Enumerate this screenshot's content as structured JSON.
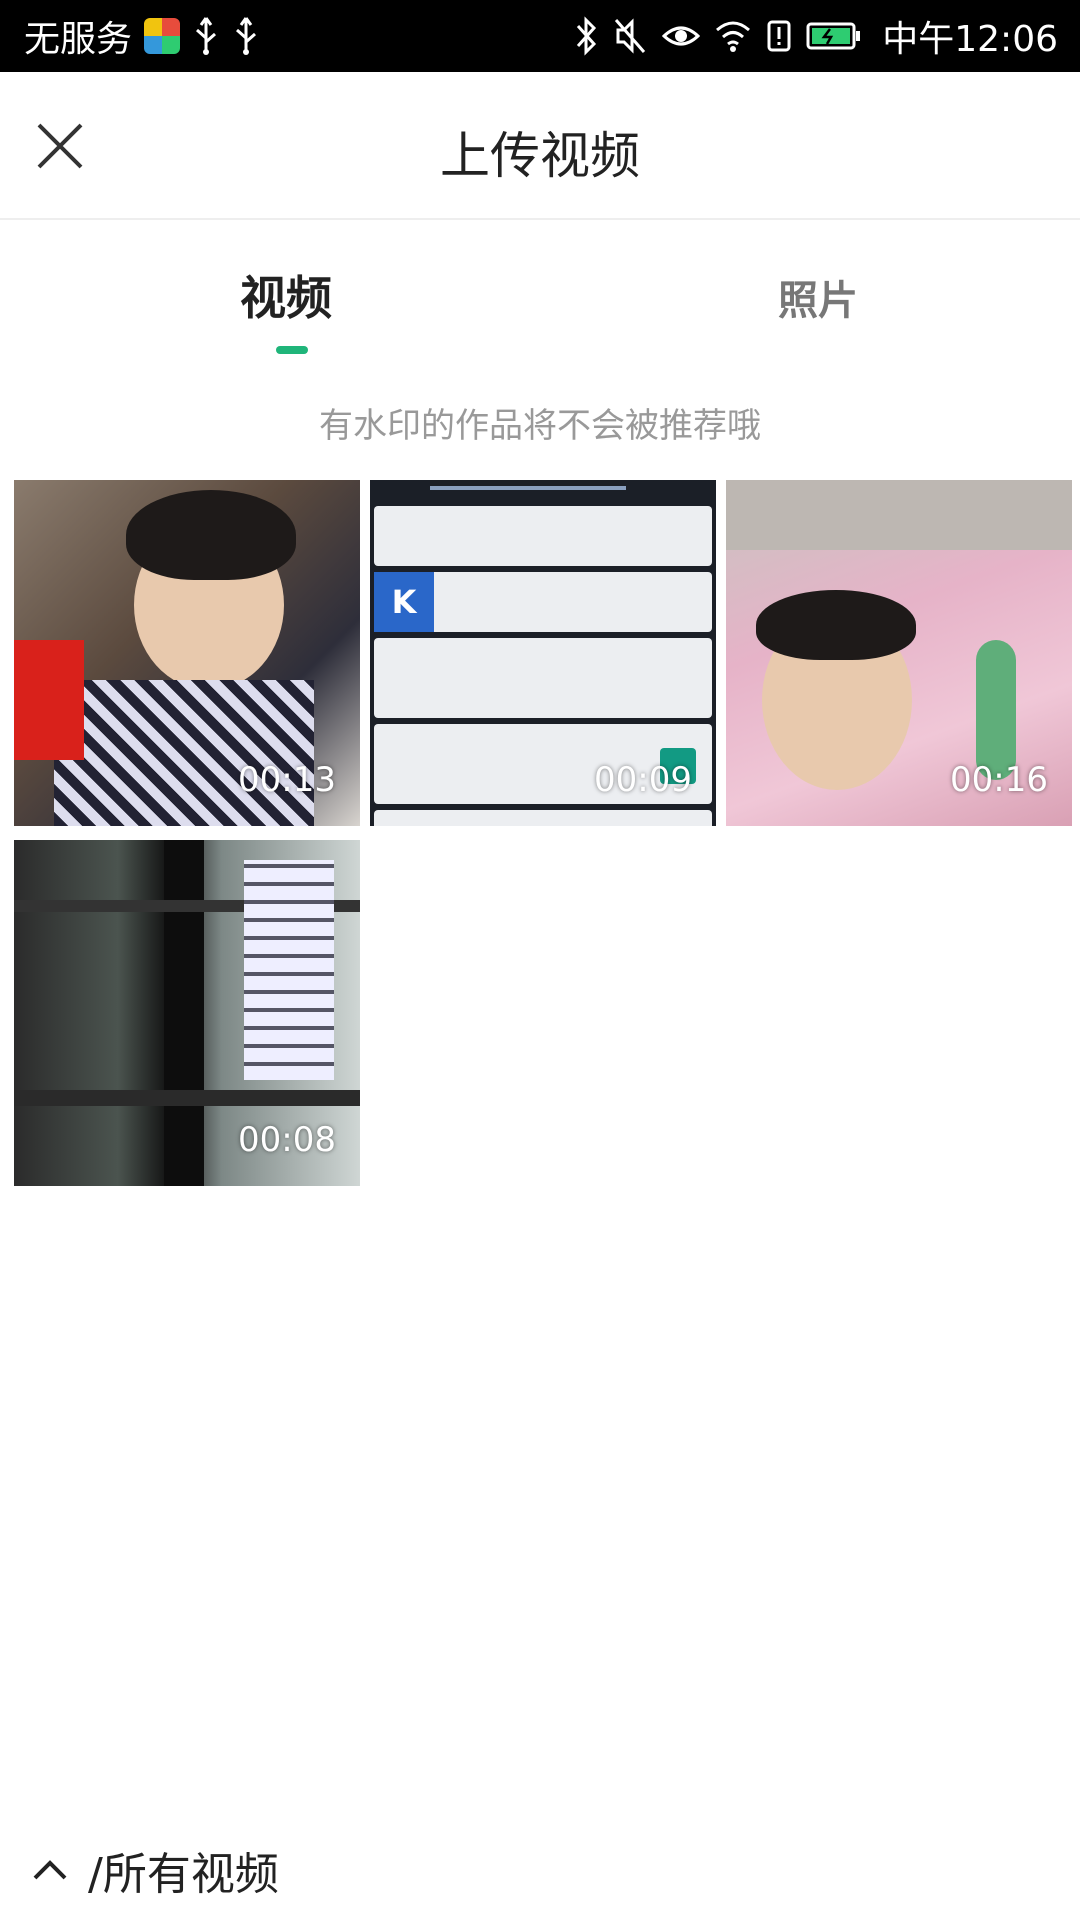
{
  "status_bar": {
    "carrier": "无服务",
    "time": "中午12:06",
    "icons": [
      "app-icon",
      "usb-icon",
      "usb-icon",
      "bluetooth-icon",
      "mute-icon",
      "eye-icon",
      "wifi-icon",
      "alert-icon",
      "battery-charging-icon"
    ]
  },
  "header": {
    "title": "上传视频",
    "close_icon": "close-icon"
  },
  "tabs": [
    {
      "label": "视频",
      "active": true
    },
    {
      "label": "照片",
      "active": false
    }
  ],
  "notice": "有水印的作品将不会被推荐哦",
  "videos": [
    {
      "duration": "00:13"
    },
    {
      "duration": "00:09"
    },
    {
      "duration": "00:16"
    },
    {
      "duration": "00:08"
    }
  ],
  "footer": {
    "icon": "chevron-up-icon",
    "album_label": "/所有视频"
  },
  "colors": {
    "accent": "#1fb57a",
    "status_bar_bg": "#000000",
    "notice_text": "#999999"
  }
}
